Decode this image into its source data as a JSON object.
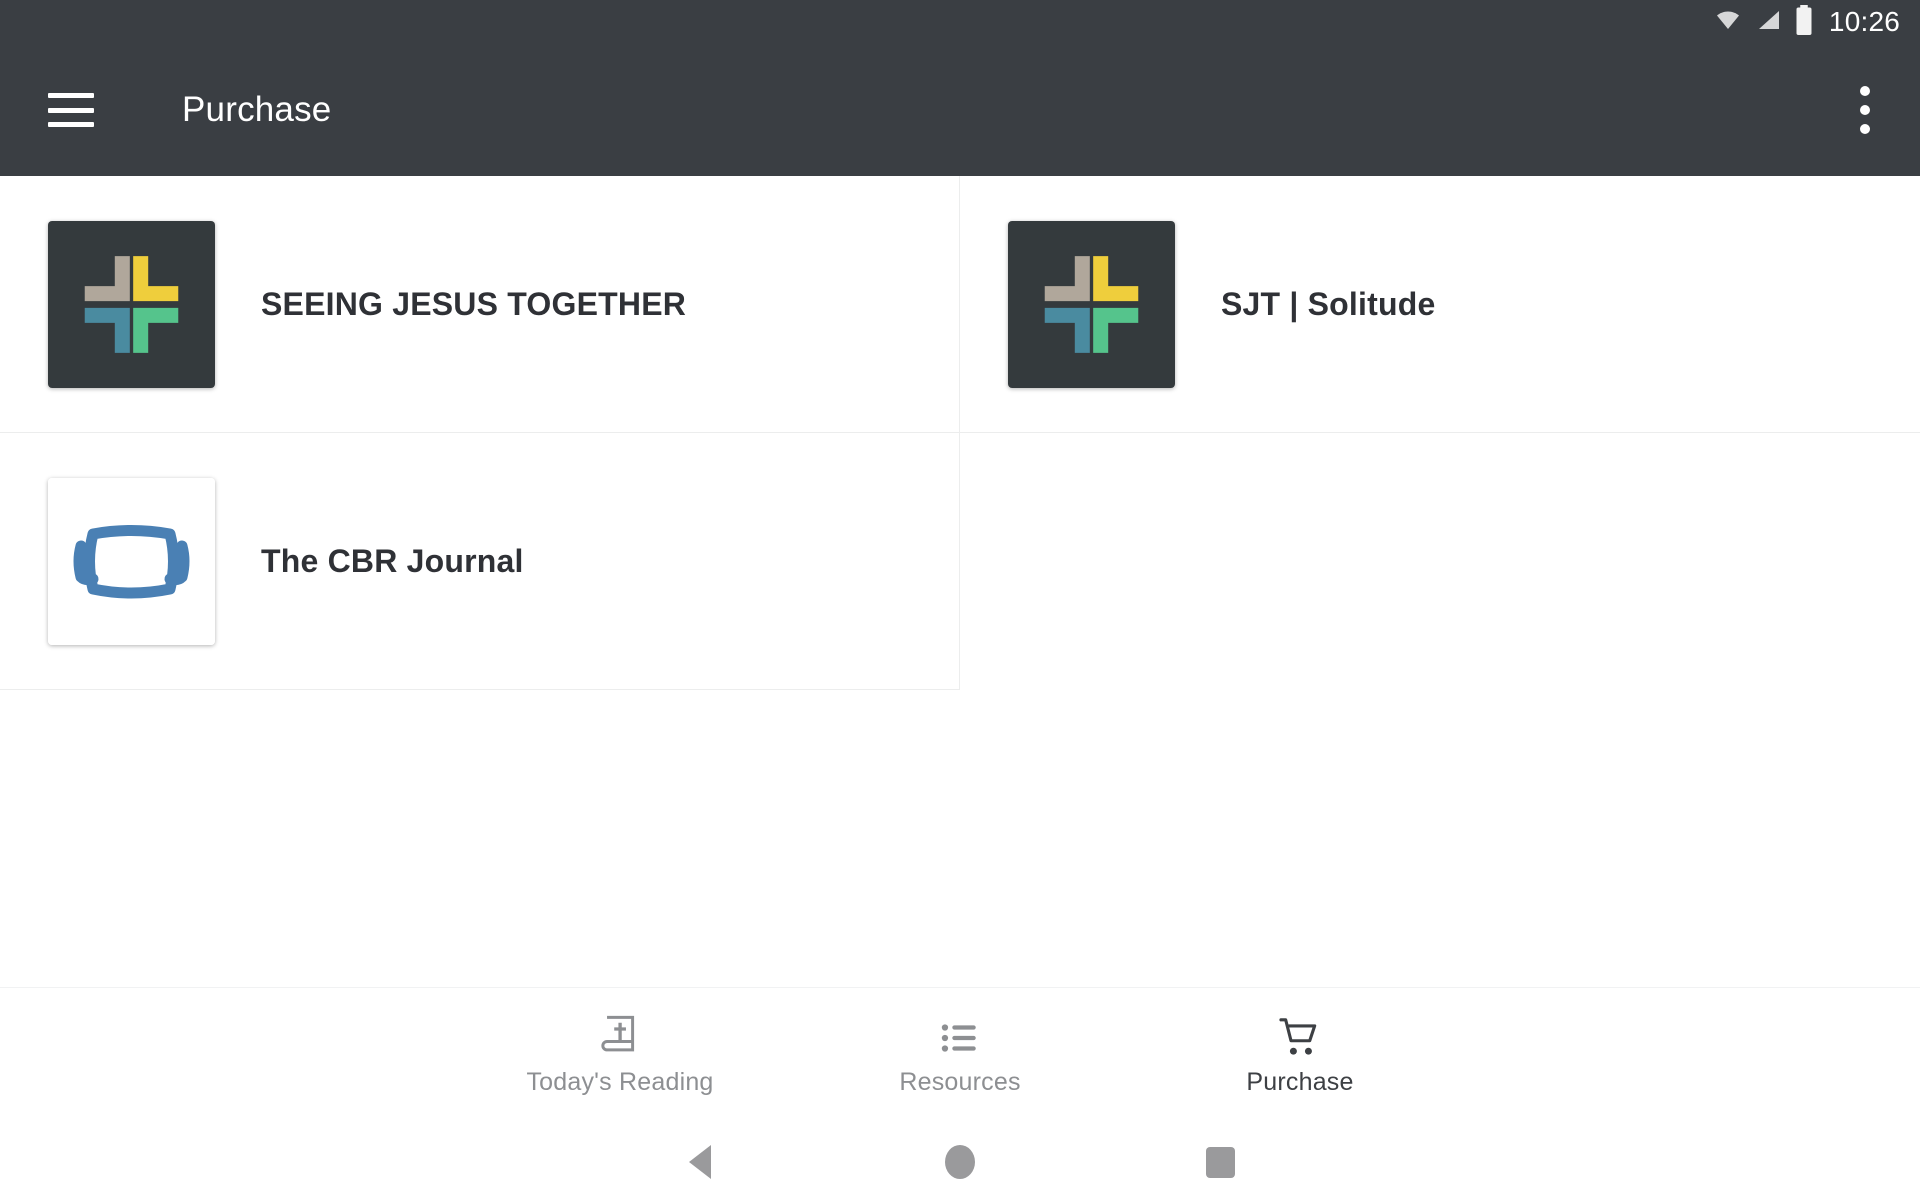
{
  "status_bar": {
    "time": "10:26",
    "icons": [
      "wifi-icon",
      "cellular-signal-icon",
      "battery-icon"
    ]
  },
  "app_bar": {
    "menu_icon": "hamburger-menu-icon",
    "title": "Purchase",
    "overflow_icon": "overflow-menu-icon"
  },
  "colors": {
    "toolbar_bg": "#3a3e43",
    "page_bg": "#ffffff",
    "divider": "#eceded",
    "text_primary": "#2f3136",
    "nav_inactive": "#8d8f92",
    "nav_active": "#3d4044",
    "logo_tile_bg": "#343a3d",
    "logo_tan": "#b0a79b",
    "logo_yellow": "#efce3c",
    "logo_teal": "#4a8ba0",
    "logo_green": "#55c48c",
    "journal_blue": "#4a80b4"
  },
  "items": [
    {
      "label": "SEEING JESUS TOGETHER",
      "icon": "sjt-cross-logo-icon",
      "thumb_type": "sjt"
    },
    {
      "label": "SJT | Solitude",
      "icon": "sjt-cross-logo-icon",
      "thumb_type": "sjt"
    },
    {
      "label": "The CBR Journal",
      "icon": "cbr-journal-logo-icon",
      "thumb_type": "cbr"
    }
  ],
  "bottom_nav": {
    "items": [
      {
        "label": "Today's Reading",
        "icon": "bible-book-icon",
        "active": false
      },
      {
        "label": "Resources",
        "icon": "list-icon",
        "active": false
      },
      {
        "label": "Purchase",
        "icon": "shopping-cart-icon",
        "active": true
      }
    ]
  },
  "system_nav": {
    "back": "back-triangle-icon",
    "home": "home-circle-icon",
    "recents": "recents-square-icon"
  }
}
